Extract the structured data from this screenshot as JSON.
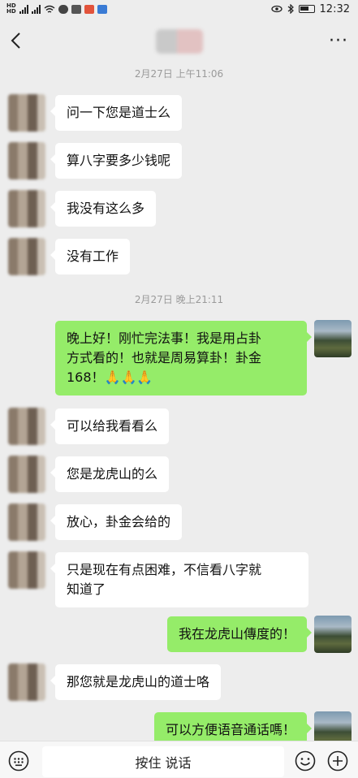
{
  "status_bar": {
    "time": "12:32"
  },
  "header": {
    "back_glyph": "<",
    "more_glyph": "···"
  },
  "timestamps": [
    "2月27日 上午11:06",
    "2月27日 晚上21:11"
  ],
  "messages": [
    {
      "side": "in",
      "text": "问一下您是道士么"
    },
    {
      "side": "in",
      "text": "算八字要多少钱呢"
    },
    {
      "side": "in",
      "text": "我没有这么多"
    },
    {
      "side": "in",
      "text": "没有工作"
    },
    {
      "side": "out",
      "text": "晚上好！刚忙完法事！我是用占卦\n方式看的！也就是周易算卦！卦金\n168！🙏🙏🙏"
    },
    {
      "side": "in",
      "text": "可以给我看看么"
    },
    {
      "side": "in",
      "text": "您是龙虎山的么"
    },
    {
      "side": "in",
      "text": "放心，卦金会给的"
    },
    {
      "side": "in",
      "text": "只是现在有点困难，不信看八字就\n知道了"
    },
    {
      "side": "out",
      "text": "我在龙虎山傳度的！"
    },
    {
      "side": "in",
      "text": "那您就是龙虎山的道士咯"
    },
    {
      "side": "out",
      "text": "可以方便语音通话嗎！"
    }
  ],
  "input_bar": {
    "hold_to_talk": "按住 说话"
  },
  "icons": {
    "voice": "keyboard-voice-icon",
    "emoji": "emoji-icon",
    "plus": "plus-icon"
  }
}
